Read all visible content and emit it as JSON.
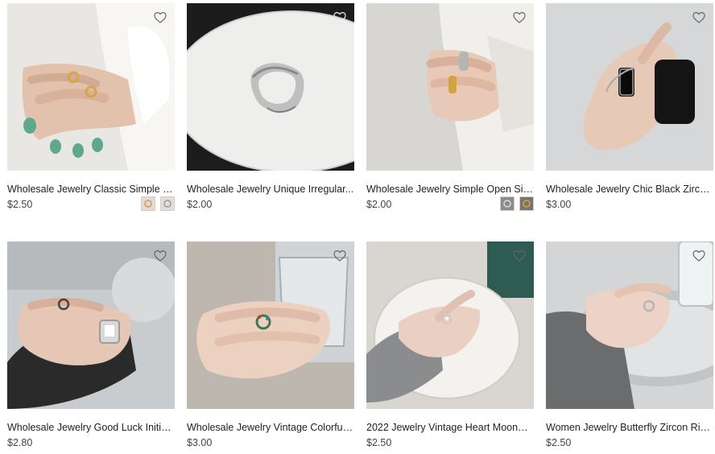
{
  "products": [
    {
      "title": "Wholesale Jewelry Classic Simple G...",
      "price": "$2.50",
      "image": "hand-with-gold-rings-white-sleeve",
      "swatches": [
        "gold-ring-swatch",
        "silver-ring-swatch"
      ]
    },
    {
      "title": "Wholesale Jewelry Unique Irregular...",
      "price": "$2.00",
      "image": "silver-ring-on-white-table",
      "swatches": []
    },
    {
      "title": "Wholesale Jewelry Simple Open Silv...",
      "price": "$2.00",
      "image": "hand-with-silver-and-gold-rings",
      "swatches": [
        "silver-swatch",
        "gold-swatch"
      ]
    },
    {
      "title": "Wholesale Jewelry Chic Black Zirco...",
      "price": "$3.00",
      "image": "hand-with-black-zircon-ring",
      "swatches": []
    },
    {
      "title": "Wholesale Jewelry Good Luck Initial...",
      "price": "$2.80",
      "image": "hand-with-square-zircon-ring",
      "swatches": []
    },
    {
      "title": "Wholesale Jewelry Vintage Colorful ...",
      "price": "$3.00",
      "image": "hand-with-colorful-ring-glass",
      "swatches": []
    },
    {
      "title": "2022 Jewelry Vintage Heart MoonSt...",
      "price": "$2.50",
      "image": "hand-with-heart-ring-plate",
      "swatches": []
    },
    {
      "title": "Women Jewelry Butterfly Zircon Rin...",
      "price": "$2.50",
      "image": "hand-with-butterfly-ring-tray",
      "swatches": []
    }
  ],
  "icons": {
    "favorite": "heart-outline-icon"
  }
}
